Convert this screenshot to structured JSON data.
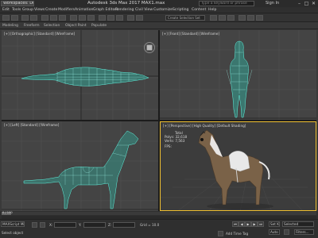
{
  "titlebar": {
    "workspace_label": "Workspaces: Default",
    "title": "Autodesk 3ds Max 2017     MAX1.max",
    "search_placeholder": "Type a keyword or phrase",
    "signin": "Sign In",
    "min_glyph": "–",
    "max_glyph": "□",
    "close_glyph": "✕"
  },
  "menubar": {
    "items": [
      "Edit",
      "Tools",
      "Group",
      "Views",
      "Create",
      "Modifiers",
      "Animation",
      "Graph Editors",
      "Rendering",
      "Civil View",
      "Customize",
      "Scripting",
      "Content",
      "Help"
    ]
  },
  "ribbon": {
    "tabs": [
      "Modeling",
      "Freeform",
      "Selection",
      "Object Paint",
      "Populate"
    ],
    "create_selection_set": "Create Selection Set"
  },
  "toolbar2": {
    "items": [
      "Polygon Modeling",
      "Modify Selection",
      "Edit",
      "Geometry (All)"
    ]
  },
  "viewports": {
    "top": {
      "label": "[+] [Orthographic] [Standard] [Wireframe]"
    },
    "front": {
      "label": "[+] [Front] [Standard] [Wireframe]"
    },
    "left": {
      "label": "[+] [Left] [Standard] [Wireframe]"
    },
    "perspective": {
      "label": "[+] [Perspective] [High Quality] [Default Shading]",
      "stats": [
        "Total",
        "Polys:  32,618",
        "Verts:  7,563",
        "FPS:"
      ]
    }
  },
  "timeline": {
    "frame_readout": "0 / 100",
    "ticks": [
      "0",
      "10",
      "20",
      "30",
      "40",
      "50",
      "60",
      "70",
      "80",
      "90",
      "100"
    ]
  },
  "statusbar": {
    "script_label": "MAXScript Mi",
    "status_text": "Select object",
    "selected_label": "Selected",
    "x_label": "X:",
    "y_label": "Y:",
    "z_label": "Z:",
    "x_value": "",
    "y_value": "",
    "z_value": "",
    "grid_label": "Grid = 10.0",
    "add_time_tag": "Add Time Tag",
    "set_key": "Set K.",
    "auto_key": "Auto",
    "key_filters": "Filters...",
    "selected_dropdown": "Selected",
    "play_glyphs": [
      "⏮",
      "◀",
      "▶",
      "▶",
      "⏭"
    ]
  }
}
